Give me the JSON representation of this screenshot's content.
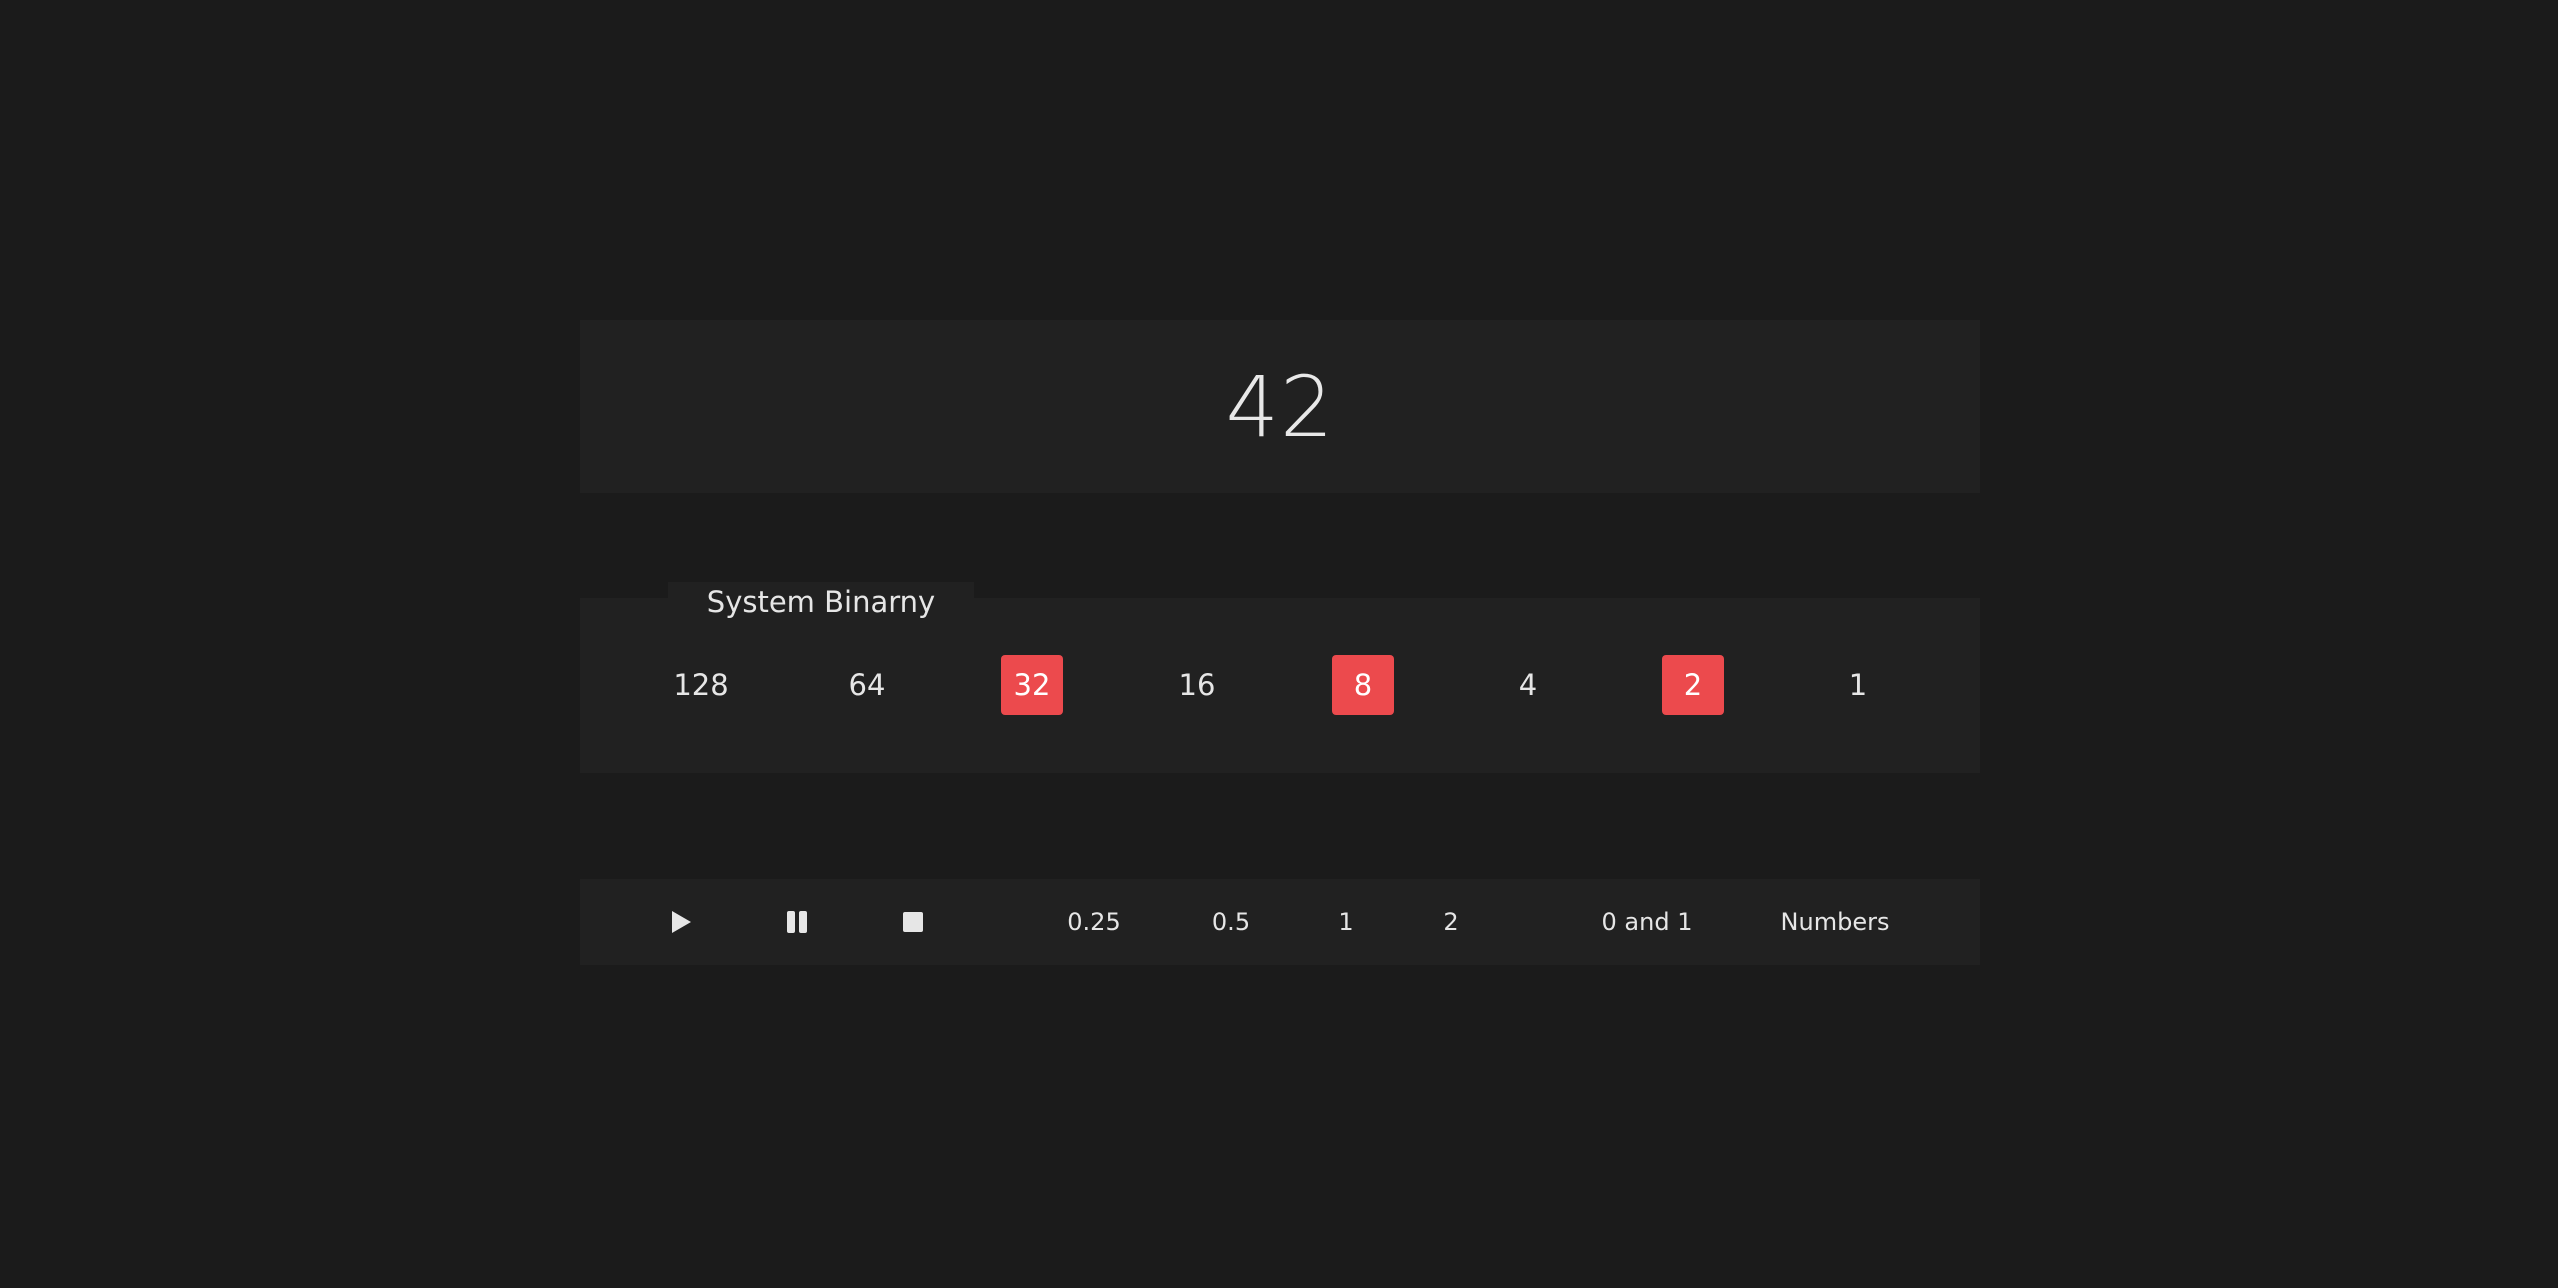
{
  "display": {
    "value": "42"
  },
  "binary": {
    "tab_label": "System Binarny",
    "bits": [
      {
        "label": "128",
        "on": false
      },
      {
        "label": "64",
        "on": false
      },
      {
        "label": "32",
        "on": true
      },
      {
        "label": "16",
        "on": false
      },
      {
        "label": "8",
        "on": true
      },
      {
        "label": "4",
        "on": false
      },
      {
        "label": "2",
        "on": true
      },
      {
        "label": "1",
        "on": false
      }
    ]
  },
  "controls": {
    "playback": [
      {
        "icon": "play-icon"
      },
      {
        "icon": "pause-icon"
      },
      {
        "icon": "stop-icon"
      }
    ],
    "speeds": [
      "0.25",
      "0.5",
      "1",
      "2"
    ],
    "modes": [
      "0 and 1",
      "Numbers"
    ]
  },
  "colors": {
    "background": "#1b1b1b",
    "panel": "#212121",
    "active_bit": "#ec4a4d",
    "text": "#e6e6e6"
  }
}
